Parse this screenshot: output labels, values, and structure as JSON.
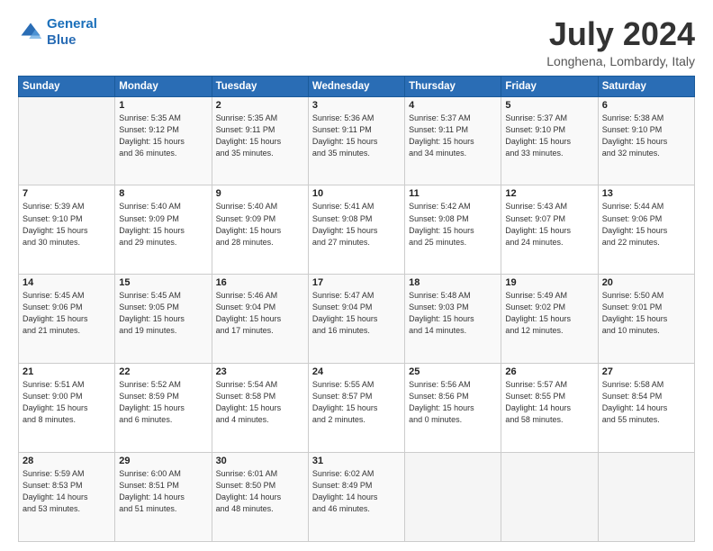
{
  "header": {
    "logo_line1": "General",
    "logo_line2": "Blue",
    "month": "July 2024",
    "location": "Longhena, Lombardy, Italy"
  },
  "weekdays": [
    "Sunday",
    "Monday",
    "Tuesday",
    "Wednesday",
    "Thursday",
    "Friday",
    "Saturday"
  ],
  "weeks": [
    [
      {
        "day": "",
        "info": ""
      },
      {
        "day": "1",
        "info": "Sunrise: 5:35 AM\nSunset: 9:12 PM\nDaylight: 15 hours\nand 36 minutes."
      },
      {
        "day": "2",
        "info": "Sunrise: 5:35 AM\nSunset: 9:11 PM\nDaylight: 15 hours\nand 35 minutes."
      },
      {
        "day": "3",
        "info": "Sunrise: 5:36 AM\nSunset: 9:11 PM\nDaylight: 15 hours\nand 35 minutes."
      },
      {
        "day": "4",
        "info": "Sunrise: 5:37 AM\nSunset: 9:11 PM\nDaylight: 15 hours\nand 34 minutes."
      },
      {
        "day": "5",
        "info": "Sunrise: 5:37 AM\nSunset: 9:10 PM\nDaylight: 15 hours\nand 33 minutes."
      },
      {
        "day": "6",
        "info": "Sunrise: 5:38 AM\nSunset: 9:10 PM\nDaylight: 15 hours\nand 32 minutes."
      }
    ],
    [
      {
        "day": "7",
        "info": "Sunrise: 5:39 AM\nSunset: 9:10 PM\nDaylight: 15 hours\nand 30 minutes."
      },
      {
        "day": "8",
        "info": "Sunrise: 5:40 AM\nSunset: 9:09 PM\nDaylight: 15 hours\nand 29 minutes."
      },
      {
        "day": "9",
        "info": "Sunrise: 5:40 AM\nSunset: 9:09 PM\nDaylight: 15 hours\nand 28 minutes."
      },
      {
        "day": "10",
        "info": "Sunrise: 5:41 AM\nSunset: 9:08 PM\nDaylight: 15 hours\nand 27 minutes."
      },
      {
        "day": "11",
        "info": "Sunrise: 5:42 AM\nSunset: 9:08 PM\nDaylight: 15 hours\nand 25 minutes."
      },
      {
        "day": "12",
        "info": "Sunrise: 5:43 AM\nSunset: 9:07 PM\nDaylight: 15 hours\nand 24 minutes."
      },
      {
        "day": "13",
        "info": "Sunrise: 5:44 AM\nSunset: 9:06 PM\nDaylight: 15 hours\nand 22 minutes."
      }
    ],
    [
      {
        "day": "14",
        "info": "Sunrise: 5:45 AM\nSunset: 9:06 PM\nDaylight: 15 hours\nand 21 minutes."
      },
      {
        "day": "15",
        "info": "Sunrise: 5:45 AM\nSunset: 9:05 PM\nDaylight: 15 hours\nand 19 minutes."
      },
      {
        "day": "16",
        "info": "Sunrise: 5:46 AM\nSunset: 9:04 PM\nDaylight: 15 hours\nand 17 minutes."
      },
      {
        "day": "17",
        "info": "Sunrise: 5:47 AM\nSunset: 9:04 PM\nDaylight: 15 hours\nand 16 minutes."
      },
      {
        "day": "18",
        "info": "Sunrise: 5:48 AM\nSunset: 9:03 PM\nDaylight: 15 hours\nand 14 minutes."
      },
      {
        "day": "19",
        "info": "Sunrise: 5:49 AM\nSunset: 9:02 PM\nDaylight: 15 hours\nand 12 minutes."
      },
      {
        "day": "20",
        "info": "Sunrise: 5:50 AM\nSunset: 9:01 PM\nDaylight: 15 hours\nand 10 minutes."
      }
    ],
    [
      {
        "day": "21",
        "info": "Sunrise: 5:51 AM\nSunset: 9:00 PM\nDaylight: 15 hours\nand 8 minutes."
      },
      {
        "day": "22",
        "info": "Sunrise: 5:52 AM\nSunset: 8:59 PM\nDaylight: 15 hours\nand 6 minutes."
      },
      {
        "day": "23",
        "info": "Sunrise: 5:54 AM\nSunset: 8:58 PM\nDaylight: 15 hours\nand 4 minutes."
      },
      {
        "day": "24",
        "info": "Sunrise: 5:55 AM\nSunset: 8:57 PM\nDaylight: 15 hours\nand 2 minutes."
      },
      {
        "day": "25",
        "info": "Sunrise: 5:56 AM\nSunset: 8:56 PM\nDaylight: 15 hours\nand 0 minutes."
      },
      {
        "day": "26",
        "info": "Sunrise: 5:57 AM\nSunset: 8:55 PM\nDaylight: 14 hours\nand 58 minutes."
      },
      {
        "day": "27",
        "info": "Sunrise: 5:58 AM\nSunset: 8:54 PM\nDaylight: 14 hours\nand 55 minutes."
      }
    ],
    [
      {
        "day": "28",
        "info": "Sunrise: 5:59 AM\nSunset: 8:53 PM\nDaylight: 14 hours\nand 53 minutes."
      },
      {
        "day": "29",
        "info": "Sunrise: 6:00 AM\nSunset: 8:51 PM\nDaylight: 14 hours\nand 51 minutes."
      },
      {
        "day": "30",
        "info": "Sunrise: 6:01 AM\nSunset: 8:50 PM\nDaylight: 14 hours\nand 48 minutes."
      },
      {
        "day": "31",
        "info": "Sunrise: 6:02 AM\nSunset: 8:49 PM\nDaylight: 14 hours\nand 46 minutes."
      },
      {
        "day": "",
        "info": ""
      },
      {
        "day": "",
        "info": ""
      },
      {
        "day": "",
        "info": ""
      }
    ]
  ]
}
